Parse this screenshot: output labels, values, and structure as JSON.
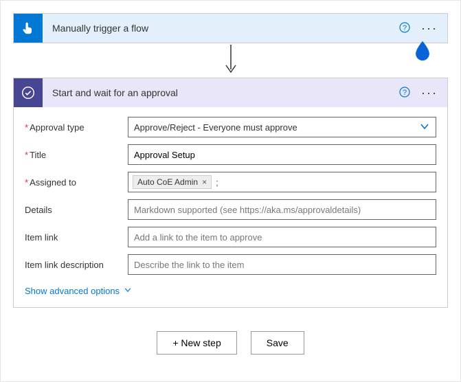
{
  "trigger": {
    "title": "Manually trigger a flow"
  },
  "action": {
    "title": "Start and wait for an approval",
    "fields": {
      "approval_type": {
        "label": "Approval type",
        "value": "Approve/Reject - Everyone must approve"
      },
      "title": {
        "label": "Title",
        "value": "Approval Setup"
      },
      "assigned_to": {
        "label": "Assigned to",
        "chip": "Auto CoE Admin"
      },
      "details": {
        "label": "Details",
        "placeholder": "Markdown supported (see https://aka.ms/approvaldetails)"
      },
      "item_link": {
        "label": "Item link",
        "placeholder": "Add a link to the item to approve"
      },
      "item_link_desc": {
        "label": "Item link description",
        "placeholder": "Describe the link to the item"
      }
    },
    "advanced": "Show advanced options"
  },
  "footer": {
    "new_step": "+ New step",
    "save": "Save"
  },
  "glyphs": {
    "semicolon": ";",
    "x": "×"
  }
}
